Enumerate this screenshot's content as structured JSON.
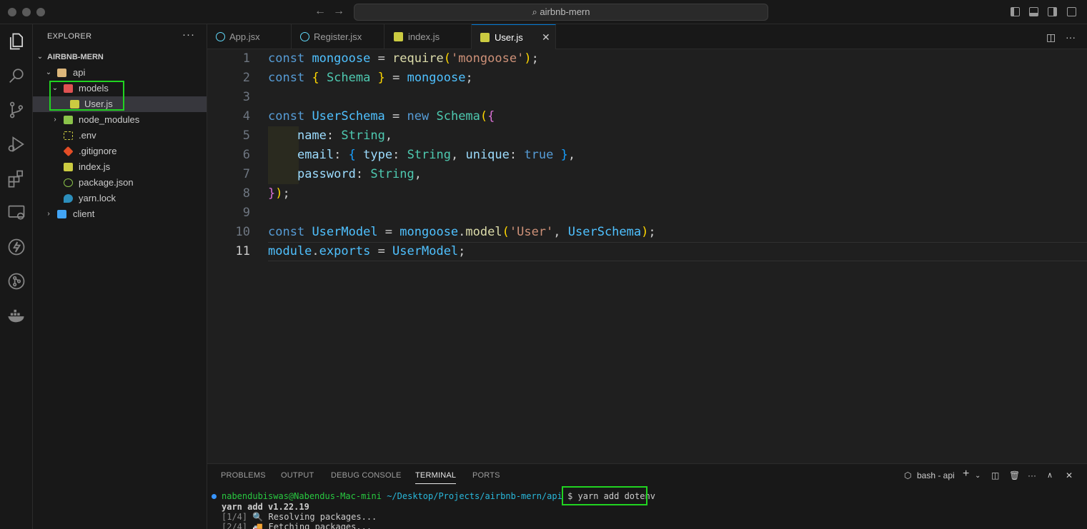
{
  "window": {
    "search_text": "airbnb-mern"
  },
  "explorer": {
    "header": "EXPLORER",
    "more": "···",
    "root": "AIRBNB-MERN",
    "items": [
      {
        "label": "api"
      },
      {
        "label": "models"
      },
      {
        "label": "User.js"
      },
      {
        "label": "node_modules"
      },
      {
        "label": ".env"
      },
      {
        "label": ".gitignore"
      },
      {
        "label": "index.js"
      },
      {
        "label": "package.json"
      },
      {
        "label": "yarn.lock"
      },
      {
        "label": "client"
      }
    ]
  },
  "tabs": [
    {
      "label": "App.jsx"
    },
    {
      "label": "Register.jsx"
    },
    {
      "label": "index.js"
    },
    {
      "label": "User.js",
      "active": true
    }
  ],
  "editor": {
    "line_numbers": [
      "1",
      "2",
      "3",
      "4",
      "5",
      "6",
      "7",
      "8",
      "9",
      "10",
      "11"
    ],
    "current_line": 11
  },
  "panel": {
    "tabs": [
      "PROBLEMS",
      "OUTPUT",
      "DEBUG CONSOLE",
      "TERMINAL",
      "PORTS"
    ],
    "active_tab": "TERMINAL",
    "shell_label": "bash - api",
    "terminal": {
      "user": "nabendubiswas@Nabendus-Mac-mini",
      "path": "~/Desktop/Projects/airbnb-mern/api",
      "prompt": "$",
      "command": "yarn add dotenv",
      "line2": "yarn add v1.22.19",
      "line3_step": "[1/4]",
      "line3_text": "Resolving packages...",
      "line4_step": "[2/4]",
      "line4_text": "Fetching packages..."
    }
  },
  "colors": {
    "accent": "#0078d4",
    "highlight_box": "#21d321"
  }
}
